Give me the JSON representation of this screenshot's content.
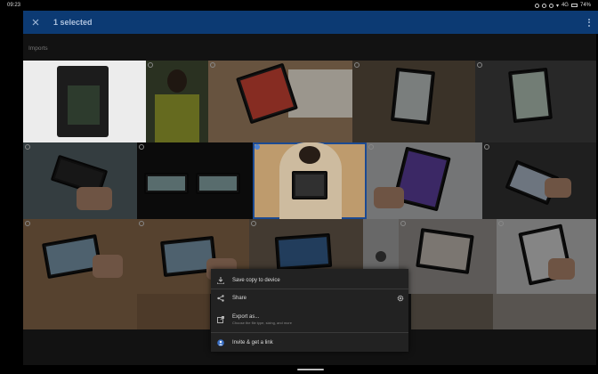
{
  "status": {
    "time": "09:23",
    "network": "4G",
    "battery": "74%"
  },
  "appbar": {
    "title": "1 selected"
  },
  "section": {
    "title": "Imports"
  },
  "menu": {
    "save_label": "Save copy to device",
    "share_label": "Share",
    "export_label": "Export as...",
    "export_sub": "Choose the file type, sizing, and more",
    "invite_label": "Invite & get a link"
  },
  "icons": {
    "close": "close-icon",
    "more": "more-vert-icon",
    "download": "download-icon",
    "share": "share-icon",
    "gear": "gear-icon",
    "export": "export-icon",
    "invite": "add-person-icon"
  },
  "colors": {
    "appbar": "#0c3a73",
    "selection": "#1e4f9a",
    "menu_bg": "#222222"
  }
}
